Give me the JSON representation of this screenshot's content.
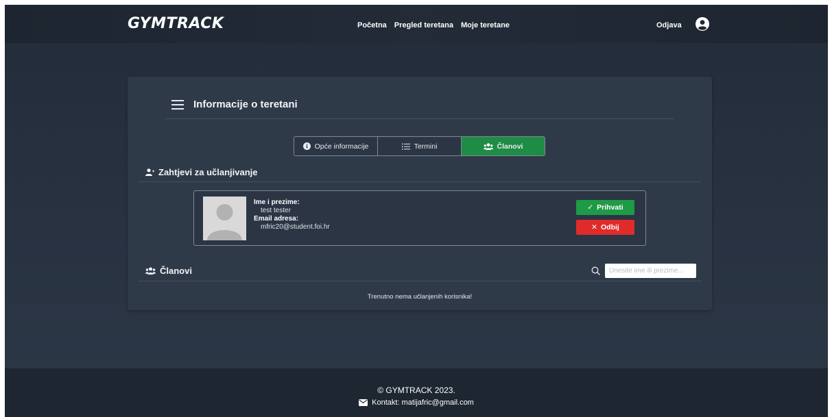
{
  "header": {
    "logo": "GYMTRACK",
    "nav": [
      "Početna",
      "Pregled teretana",
      "Moje teretane"
    ],
    "logout_label": "Odjava",
    "user_icon": "user-circle-icon"
  },
  "card": {
    "title": "Informacije o teretani",
    "tabs": [
      {
        "label": "Opće informacije",
        "icon": "info-circle-icon"
      },
      {
        "label": "Termini",
        "icon": "list-icon"
      },
      {
        "label": "Članovi",
        "icon": "users-icon",
        "active": true
      }
    ],
    "requests": {
      "heading": "Zahtjevi za učlanjivanje",
      "items": [
        {
          "name_label": "Ime i prezime:",
          "name": "test tester",
          "email_label": "Email adresa:",
          "email": "mfric20@student.foi.hr",
          "accept_label": "Prihvati",
          "reject_label": "Odbij"
        }
      ]
    },
    "members": {
      "heading": "Članovi",
      "search_placeholder": "Unesite ime ili prezime...",
      "empty_message": "Trenutno nema učlanjenih korisnika!"
    }
  },
  "footer": {
    "copyright": "© GYMTRACK 2023.",
    "contact": "Kontakt: matijafric@gmail.com"
  },
  "colors": {
    "accent_green": "#1f8c45",
    "reject_red": "#e02b2b",
    "card_bg": "#2f3a49"
  }
}
